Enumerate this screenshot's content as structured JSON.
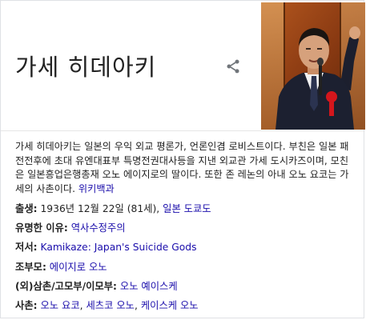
{
  "title": "가세 히데아키",
  "share_icon": "share-icon",
  "photo_alt": "portrait-photo",
  "description": {
    "text": "가세 히데아키는 일본의 우익 외교 평론가, 언론인겸 로비스트이다. 부친은 일본 패전전후에 초대 유엔대표부 특명전권대사등을 지낸 외교관 가세 도시카즈이며, 모친은 일본흥업은행총재 오노 에이지로의 딸이다. 또한 존 레논의 아내 오노 요코는 가세의 사촌이다.",
    "source_link": "위키백과"
  },
  "facts": {
    "born": {
      "label": "출생:",
      "value": "1936년 12월 22일 (81세),",
      "place": "일본 도쿄도"
    },
    "known_for": {
      "label": "유명한 이유:",
      "value": "역사수정주의"
    },
    "books": {
      "label": "저서:",
      "value": "Kamikaze: Japan's Suicide Gods"
    },
    "grandparents": {
      "label": "조부모:",
      "value": "에이지로 오노"
    },
    "uncles_aunts": {
      "label": "(외)삼촌/고모부/이모부:",
      "value": "오노 예이스케"
    },
    "cousins": {
      "label": "사촌:",
      "value1": "오노 요코",
      "sep1": ",",
      "value2": "세츠코 오노",
      "sep2": ",",
      "value3": "케이스케 오노"
    }
  },
  "colors": {
    "link": "#1a0dab",
    "text": "#222222",
    "border": "#dfe1e5"
  }
}
